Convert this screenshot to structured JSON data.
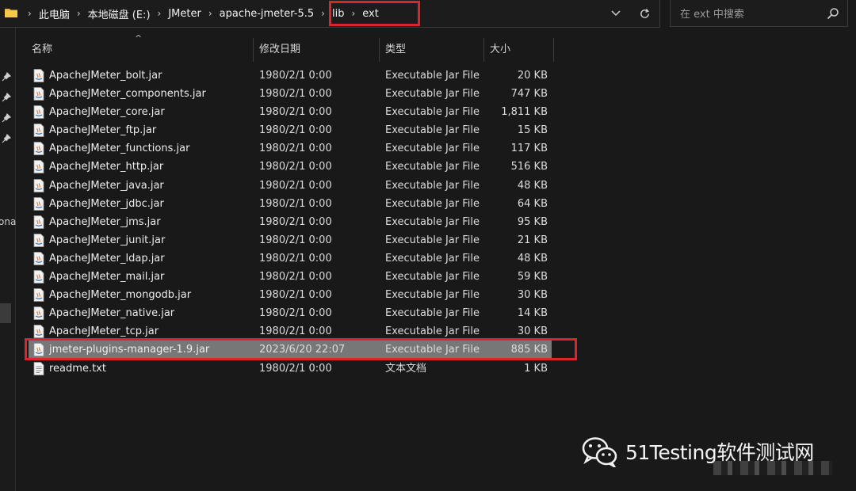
{
  "address_bar": {
    "breadcrumbs": [
      "此电脑",
      "本地磁盘 (E:)",
      "JMeter",
      "apache-jmeter-5.5",
      "lib",
      "ext"
    ]
  },
  "search": {
    "placeholder": "在 ext 中搜索"
  },
  "nav_pane": {
    "partial_label": "ona"
  },
  "columns": {
    "name": "名称",
    "date": "修改日期",
    "type": "类型",
    "size": "大小"
  },
  "files": [
    {
      "name": "ApacheJMeter_bolt.jar",
      "date": "1980/2/1 0:00",
      "type": "Executable Jar File",
      "size": "20 KB",
      "icon": "jar-file-icon"
    },
    {
      "name": "ApacheJMeter_components.jar",
      "date": "1980/2/1 0:00",
      "type": "Executable Jar File",
      "size": "747 KB",
      "icon": "jar-file-icon"
    },
    {
      "name": "ApacheJMeter_core.jar",
      "date": "1980/2/1 0:00",
      "type": "Executable Jar File",
      "size": "1,811 KB",
      "icon": "jar-file-icon"
    },
    {
      "name": "ApacheJMeter_ftp.jar",
      "date": "1980/2/1 0:00",
      "type": "Executable Jar File",
      "size": "15 KB",
      "icon": "jar-file-icon"
    },
    {
      "name": "ApacheJMeter_functions.jar",
      "date": "1980/2/1 0:00",
      "type": "Executable Jar File",
      "size": "117 KB",
      "icon": "jar-file-icon"
    },
    {
      "name": "ApacheJMeter_http.jar",
      "date": "1980/2/1 0:00",
      "type": "Executable Jar File",
      "size": "516 KB",
      "icon": "jar-file-icon"
    },
    {
      "name": "ApacheJMeter_java.jar",
      "date": "1980/2/1 0:00",
      "type": "Executable Jar File",
      "size": "48 KB",
      "icon": "jar-file-icon"
    },
    {
      "name": "ApacheJMeter_jdbc.jar",
      "date": "1980/2/1 0:00",
      "type": "Executable Jar File",
      "size": "64 KB",
      "icon": "jar-file-icon"
    },
    {
      "name": "ApacheJMeter_jms.jar",
      "date": "1980/2/1 0:00",
      "type": "Executable Jar File",
      "size": "95 KB",
      "icon": "jar-file-icon"
    },
    {
      "name": "ApacheJMeter_junit.jar",
      "date": "1980/2/1 0:00",
      "type": "Executable Jar File",
      "size": "21 KB",
      "icon": "jar-file-icon"
    },
    {
      "name": "ApacheJMeter_ldap.jar",
      "date": "1980/2/1 0:00",
      "type": "Executable Jar File",
      "size": "48 KB",
      "icon": "jar-file-icon"
    },
    {
      "name": "ApacheJMeter_mail.jar",
      "date": "1980/2/1 0:00",
      "type": "Executable Jar File",
      "size": "59 KB",
      "icon": "jar-file-icon"
    },
    {
      "name": "ApacheJMeter_mongodb.jar",
      "date": "1980/2/1 0:00",
      "type": "Executable Jar File",
      "size": "30 KB",
      "icon": "jar-file-icon"
    },
    {
      "name": "ApacheJMeter_native.jar",
      "date": "1980/2/1 0:00",
      "type": "Executable Jar File",
      "size": "14 KB",
      "icon": "jar-file-icon"
    },
    {
      "name": "ApacheJMeter_tcp.jar",
      "date": "1980/2/1 0:00",
      "type": "Executable Jar File",
      "size": "30 KB",
      "icon": "jar-file-icon"
    },
    {
      "name": "jmeter-plugins-manager-1.9.jar",
      "date": "2023/6/20 22:07",
      "type": "Executable Jar File",
      "size": "885 KB",
      "icon": "jar-file-icon",
      "selected": true
    },
    {
      "name": "readme.txt",
      "date": "1980/2/1 0:00",
      "type": "文本文档",
      "size": "1 KB",
      "icon": "text-file-icon"
    }
  ],
  "watermark": {
    "text": "51Testing软件测试网"
  },
  "colors": {
    "highlight": "#d8262b",
    "background": "#191919",
    "selected_row": "#777777"
  }
}
